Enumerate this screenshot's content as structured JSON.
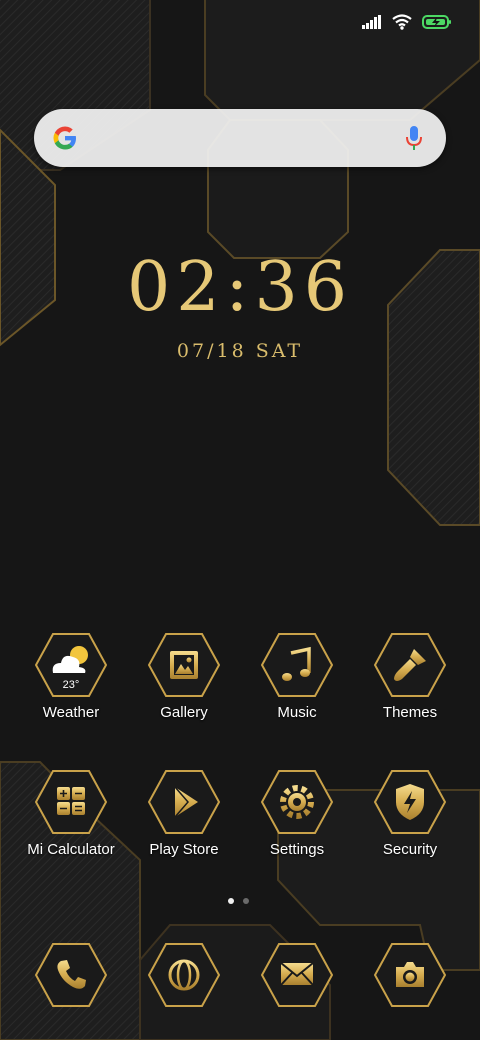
{
  "status_bar": {
    "signal_icon": "signal-bars-icon",
    "wifi_icon": "wifi-icon",
    "battery_icon": "battery-charging-icon",
    "battery_color": "#4cd964"
  },
  "search_bar": {
    "logo_icon": "google-logo-icon",
    "mic_icon": "microphone-icon"
  },
  "clock": {
    "time": "02:36",
    "date": "07/18 SAT",
    "color": "#e6c877"
  },
  "apps_row1": [
    {
      "label": "Weather",
      "icon": "weather-cloud-sun-icon",
      "badge": "23°"
    },
    {
      "label": "Gallery",
      "icon": "gallery-image-icon"
    },
    {
      "label": "Music",
      "icon": "music-note-icon"
    },
    {
      "label": "Themes",
      "icon": "paintbrush-icon"
    }
  ],
  "apps_row2": [
    {
      "label": "Mi Calculator",
      "icon": "calculator-icon"
    },
    {
      "label": "Play Store",
      "icon": "play-store-icon"
    },
    {
      "label": "Settings",
      "icon": "gear-icon"
    },
    {
      "label": "Security",
      "icon": "shield-bolt-icon"
    }
  ],
  "page_indicator": {
    "pages": 2,
    "current": 1
  },
  "dock": [
    {
      "icon": "phone-icon"
    },
    {
      "icon": "browser-globe-icon"
    },
    {
      "icon": "messages-envelope-icon"
    },
    {
      "icon": "camera-icon"
    }
  ],
  "accent_gold": "#d6b35e"
}
